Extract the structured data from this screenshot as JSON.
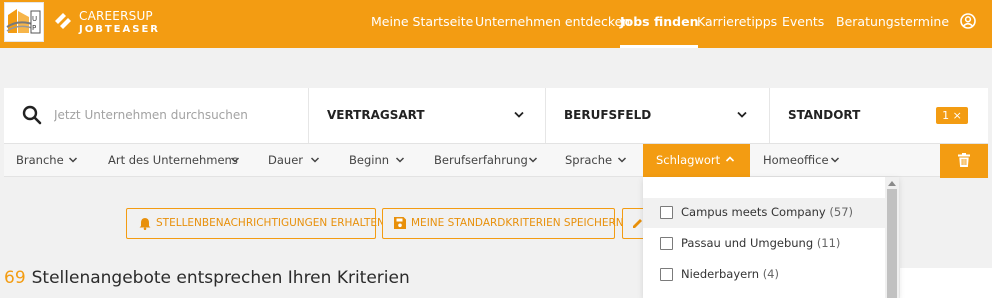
{
  "header": {
    "logo_text": "CAREERSUP",
    "logo_sub": "JOBTEASER",
    "nav": [
      {
        "label": "Meine Startseite"
      },
      {
        "label": "Unternehmen entdecken"
      },
      {
        "label": "Jobs finden"
      },
      {
        "label": "Karrieretipps"
      },
      {
        "label": "Events"
      },
      {
        "label": "Beratungstermine"
      }
    ],
    "active_nav": "Jobs finden"
  },
  "search": {
    "placeholder": "Jetzt Unternehmen durchsuchen",
    "value": "",
    "vertragsart_label": "VERTRAGSART",
    "berufsfeld_label": "BERUFSFELD",
    "standort_label": "STANDORT",
    "standort_badge": "1 ×"
  },
  "filters": [
    {
      "label": "Branche"
    },
    {
      "label": "Art des Unternehmens"
    },
    {
      "label": "Dauer"
    },
    {
      "label": "Beginn"
    },
    {
      "label": "Berufserfahrung"
    },
    {
      "label": "Sprache"
    },
    {
      "label": "Schlagwort"
    },
    {
      "label": "Homeoffice"
    }
  ],
  "active_filter": "Schlagwort",
  "actions": {
    "alert_label": "STELLENBENACHRICHTIGUNGEN ERHALTEN",
    "save_label": "MEINE STANDARDKRITERIEN SPEICHERN"
  },
  "results": {
    "count": "69",
    "text": "Stellenangebote entsprechen Ihren Kriterien"
  },
  "schlagwort_dropdown": {
    "options": [
      {
        "label": "Campus meets Company",
        "count": "(57)",
        "checked": false
      },
      {
        "label": "Passau und Umgebung",
        "count": "(11)",
        "checked": false
      },
      {
        "label": "Niederbayern",
        "count": "(4)",
        "checked": false
      }
    ]
  },
  "colors": {
    "accent": "#f39c12",
    "background": "#f1f1f1",
    "text": "#2b2b2b"
  }
}
